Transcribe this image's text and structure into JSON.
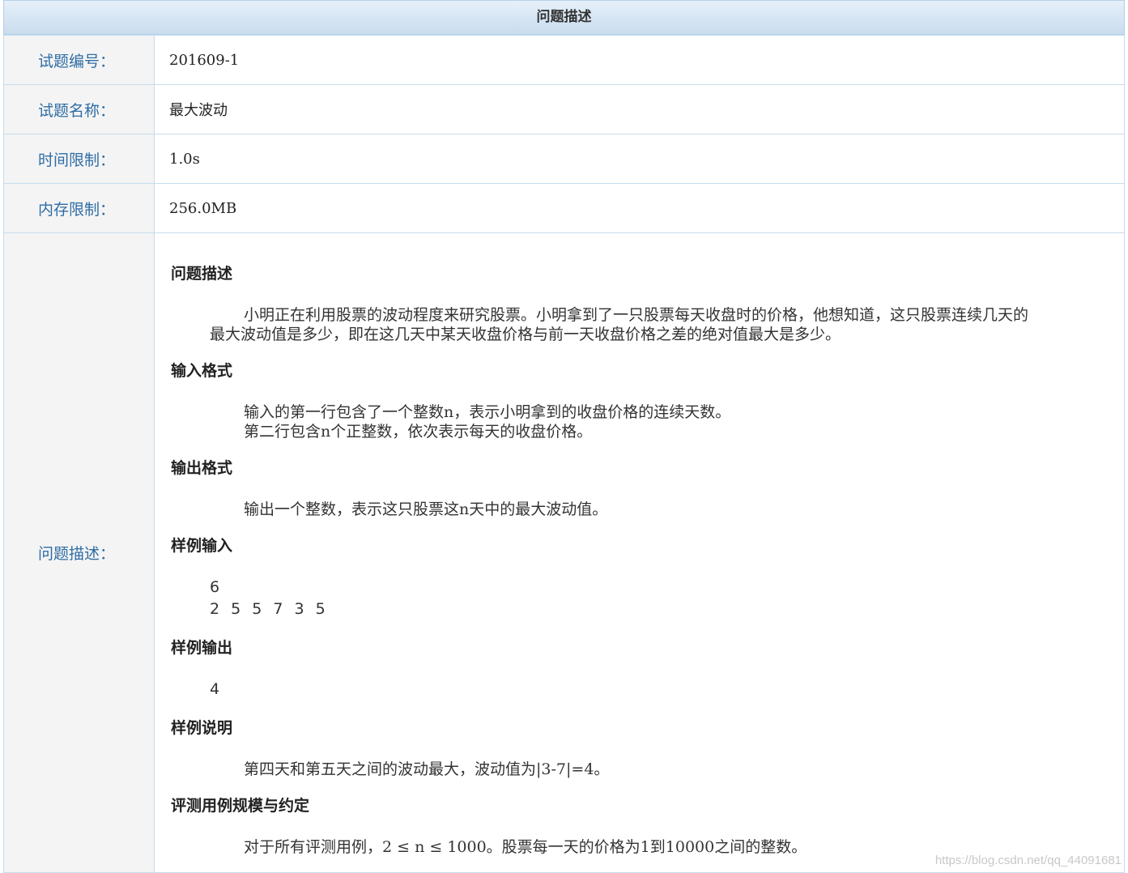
{
  "header": {
    "title": "问题描述"
  },
  "rows": [
    {
      "label": "试题编号：",
      "value": "201609-1"
    },
    {
      "label": "试题名称：",
      "value": "最大波动"
    },
    {
      "label": "时间限制：",
      "value": "1.0s"
    },
    {
      "label": "内存限制：",
      "value": "256.0MB"
    }
  ],
  "description": {
    "label": "问题描述：",
    "sections": {
      "problem": {
        "title": "问题描述",
        "text_line1": "小明正在利用股票的波动程度来研究股票。小明拿到了一只股票每天收盘时的价格，他想知道，这只股票连续几天的",
        "text_line2": "最大波动值是多少，即在这几天中某天收盘价格与前一天收盘价格之差的绝对值最大是多少。"
      },
      "input": {
        "title": "输入格式",
        "line1": "输入的第一行包含了一个整数n，表示小明拿到的收盘价格的连续天数。",
        "line2": "第二行包含n个正整数，依次表示每天的收盘价格。"
      },
      "output": {
        "title": "输出格式",
        "line1": "输出一个整数，表示这只股票这n天中的最大波动值。"
      },
      "sample_input": {
        "title": "样例输入",
        "line1": "6",
        "line2": "2 5 5 7 3 5"
      },
      "sample_output": {
        "title": "样例输出",
        "line1": "4"
      },
      "sample_explain": {
        "title": "样例说明",
        "line1": "第四天和第五天之间的波动最大，波动值为|3-7|=4。"
      },
      "constraints": {
        "title": "评测用例规模与约定",
        "line1": "对于所有评测用例，2 ≤ n ≤ 1000。股票每一天的价格为1到10000之间的整数。"
      }
    }
  },
  "watermark": "https://blog.csdn.net/qq_44091681"
}
